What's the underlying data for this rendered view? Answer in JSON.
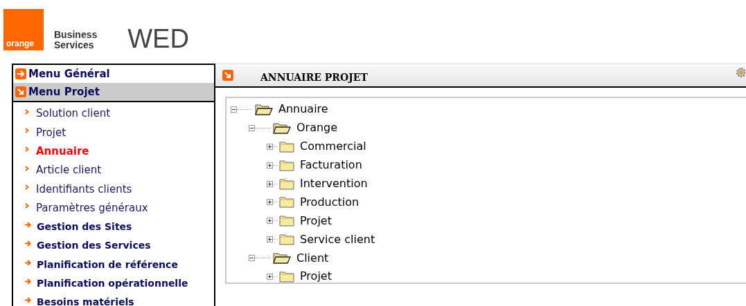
{
  "header": {
    "logo_text": "orange",
    "brand_line_1": "Business",
    "brand_line_2": "Services",
    "app_name": "WED"
  },
  "menu": [
    {
      "label": "Menu Général",
      "expanded": false
    },
    {
      "label": "Menu Projet",
      "expanded": true,
      "items": [
        {
          "label": "Solution client",
          "kind": "link",
          "selected": false
        },
        {
          "label": "Projet",
          "kind": "link",
          "selected": false
        },
        {
          "label": "Annuaire",
          "kind": "link",
          "selected": true
        },
        {
          "label": "Article client",
          "kind": "link",
          "selected": false
        },
        {
          "label": "Identifiants clients",
          "kind": "link",
          "selected": false
        },
        {
          "label": "Paramètres généraux",
          "kind": "link",
          "selected": false
        },
        {
          "label": "Gestion des Sites",
          "kind": "section",
          "selected": false
        },
        {
          "label": "Gestion des Services",
          "kind": "section",
          "selected": false
        },
        {
          "label": "Planification de référence",
          "kind": "section",
          "selected": false
        },
        {
          "label": "Planification opérationnelle",
          "kind": "section",
          "selected": false
        },
        {
          "label": "Besoins matériels",
          "kind": "section",
          "selected": false
        }
      ]
    }
  ],
  "panel": {
    "title": "ANNUAIRE PROJET",
    "tree": [
      {
        "label": "Annuaire",
        "expanded": true,
        "children": [
          {
            "label": "Orange",
            "expanded": true,
            "children": [
              {
                "label": "Commercial",
                "expanded": false
              },
              {
                "label": "Facturation",
                "expanded": false
              },
              {
                "label": "Intervention",
                "expanded": false
              },
              {
                "label": "Production",
                "expanded": false
              },
              {
                "label": "Projet",
                "expanded": false
              },
              {
                "label": "Service client",
                "expanded": false
              }
            ]
          },
          {
            "label": "Client",
            "expanded": true,
            "children": [
              {
                "label": "Projet",
                "expanded": false
              }
            ]
          }
        ]
      }
    ]
  }
}
